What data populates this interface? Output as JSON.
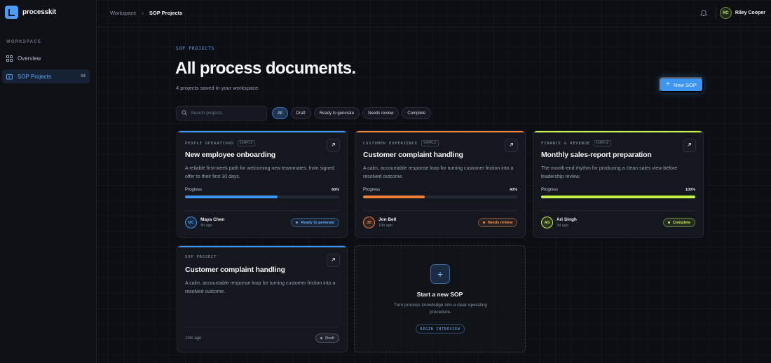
{
  "app": {
    "name": "processkit"
  },
  "sidebar": {
    "section_label": "WORKSPACE",
    "items": [
      {
        "label": "Overview",
        "icon": "grid-icon",
        "active": false
      },
      {
        "label": "SOP Projects",
        "icon": "folder-icon",
        "active": true,
        "count": "04"
      }
    ]
  },
  "topbar": {
    "breadcrumb": [
      "Workspace",
      "SOP Projects"
    ],
    "user": {
      "initials": "RC",
      "name": "Riley Cooper"
    }
  },
  "header": {
    "eyebrow": "SOP PROJECTS",
    "title": "All process documents.",
    "subtitle": "4 projects saved in your workspace.",
    "new_button": "New SOP"
  },
  "search": {
    "placeholder": "Search projects"
  },
  "filters": [
    "All",
    "Draft",
    "Ready to generate",
    "Needs review",
    "Complete"
  ],
  "cards": [
    {
      "tag": "PEOPLE OPERATIONS",
      "sample": "SAMPLE",
      "accent": "#3d96f2",
      "title": "New employee onboarding",
      "desc": "A reliable first-week path for welcoming new teammates, from signed offer to their first 30 days.",
      "progress_label": "Progress",
      "progress": "60%",
      "progress_fraction": 0.6,
      "owner": {
        "initials": "MC",
        "name": "Maya Chen",
        "time": "4h ago"
      },
      "status": "Ready to generate",
      "status_color": "#5aa8ff"
    },
    {
      "tag": "CUSTOMER EXPERIENCE",
      "sample": "SAMPLE",
      "accent": "#f07f3c",
      "title": "Customer complaint handling",
      "desc": "A calm, accountable response loop for turning customer friction into a resolved outcome.",
      "progress_label": "Progress",
      "progress": "40%",
      "progress_fraction": 0.4,
      "owner": {
        "initials": "JB",
        "name": "Jon Bell",
        "time": "19h ago"
      },
      "status": "Needs review",
      "status_color": "#f5904a"
    },
    {
      "tag": "FINANCE & REVENUE",
      "sample": "SAMPLE",
      "accent": "#c6f04a",
      "title": "Monthly sales-report preparation",
      "desc": "The month-end rhythm for producing a clean sales view before leadership review.",
      "progress_label": "Progress",
      "progress": "100%",
      "progress_fraction": 1.0,
      "owner": {
        "initials": "AS",
        "name": "Ari Singh",
        "time": "3d ago"
      },
      "status": "Complete",
      "status_color": "#c6f04a"
    },
    {
      "tag": "SOP PROJECT",
      "accent": "#3d96f2",
      "title": "Customer complaint handling",
      "desc": "A calm, accountable response loop for turning customer friction into a resolved outcome.",
      "time": "10m ago",
      "status": "Draft",
      "status_color": "#9aa1b0"
    }
  ],
  "new_card": {
    "title": "Start a new SOP",
    "desc": "Turn process knowledge into a clear operating procedure.",
    "button": "BEGIN INTERVIEW"
  }
}
